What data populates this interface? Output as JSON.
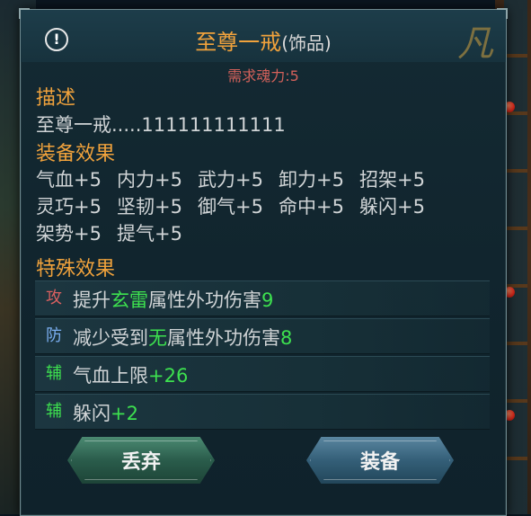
{
  "item": {
    "name": "至尊一戒",
    "type": "(饰品)",
    "rarity_mark": "凡",
    "requirement": "需求魂力:5"
  },
  "sections": {
    "description_title": "描述",
    "description_text": "至尊一戒.....111111111111",
    "equip_effects_title": "装备效果",
    "special_effects_title": "特殊效果"
  },
  "equip_stats": [
    [
      "气血+5",
      "内力+5",
      "武力+5",
      "卸力+5",
      "招架+5"
    ],
    [
      "灵巧+5",
      "坚韧+5",
      "御气+5",
      "命中+5",
      "躲闪+5"
    ],
    [
      "架势+5",
      "提气+5"
    ]
  ],
  "special_effects": [
    {
      "tag": "攻",
      "tag_color": "#d96060",
      "pre": "提升",
      "highlight": "玄雷",
      "post": "属性外功伤害",
      "value": "9"
    },
    {
      "tag": "防",
      "tag_color": "#7aaef0",
      "pre": "减少受到",
      "highlight": "无",
      "post": "属性外功伤害",
      "value": "8"
    },
    {
      "tag": "辅",
      "tag_color": "#3de04f",
      "pre": "气血上限",
      "highlight": "",
      "post": "",
      "value": "+26"
    },
    {
      "tag": "辅",
      "tag_color": "#3de04f",
      "pre": "躲闪",
      "highlight": "",
      "post": "",
      "value": "+2"
    }
  ],
  "buttons": {
    "discard": "丢弃",
    "equip": "装备"
  },
  "colors": {
    "title": "#f0a23c",
    "highlight": "#3de04f",
    "requirement": "#d4615b"
  }
}
